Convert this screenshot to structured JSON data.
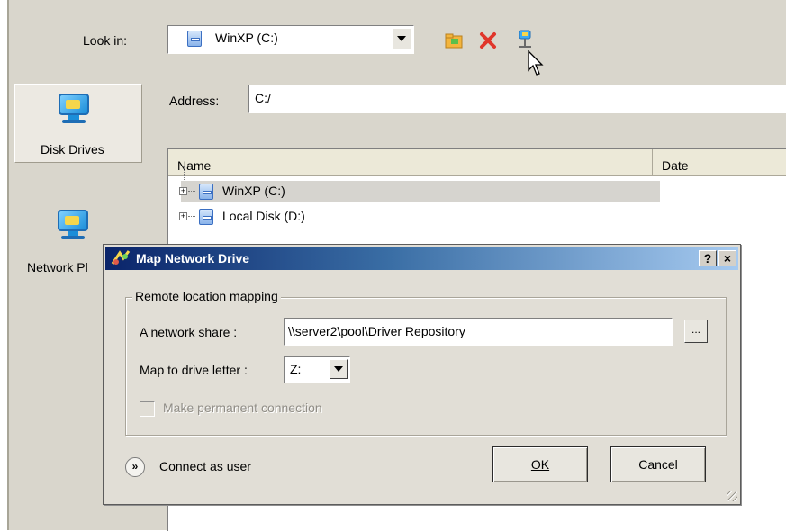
{
  "lookin": {
    "label": "Look in:",
    "value": "WinXP (C:)"
  },
  "toolbar": {
    "new_folder_icon": "new-folder-icon",
    "delete_icon": "delete-icon",
    "map_drive_icon": "map-network-drive-icon"
  },
  "sidebar": {
    "items": [
      {
        "label": "Disk Drives"
      },
      {
        "label": "Network Pl"
      }
    ]
  },
  "address": {
    "label": "Address:",
    "value": "C:/"
  },
  "list": {
    "columns": [
      "Name",
      "Date"
    ],
    "rows": [
      {
        "label": "WinXP (C:)"
      },
      {
        "label": "Local Disk (D:)"
      }
    ]
  },
  "dialog": {
    "title": "Map Network Drive",
    "help_label": "?",
    "close_label": "×",
    "group_label": "Remote location mapping",
    "share_label": "A network share   :",
    "share_value": "\\\\server2\\pool\\Driver Repository",
    "browse_label": "...",
    "drive_label": "Map to drive letter :",
    "drive_value": "Z:",
    "permanent_label": "Make permanent connection",
    "connect_as_label": "Connect as user",
    "ok_label": "OK",
    "cancel_label": "Cancel"
  },
  "colors": {
    "title_start": "#0a246a",
    "title_end": "#a6caf0",
    "frame": "#d9d6cc"
  }
}
